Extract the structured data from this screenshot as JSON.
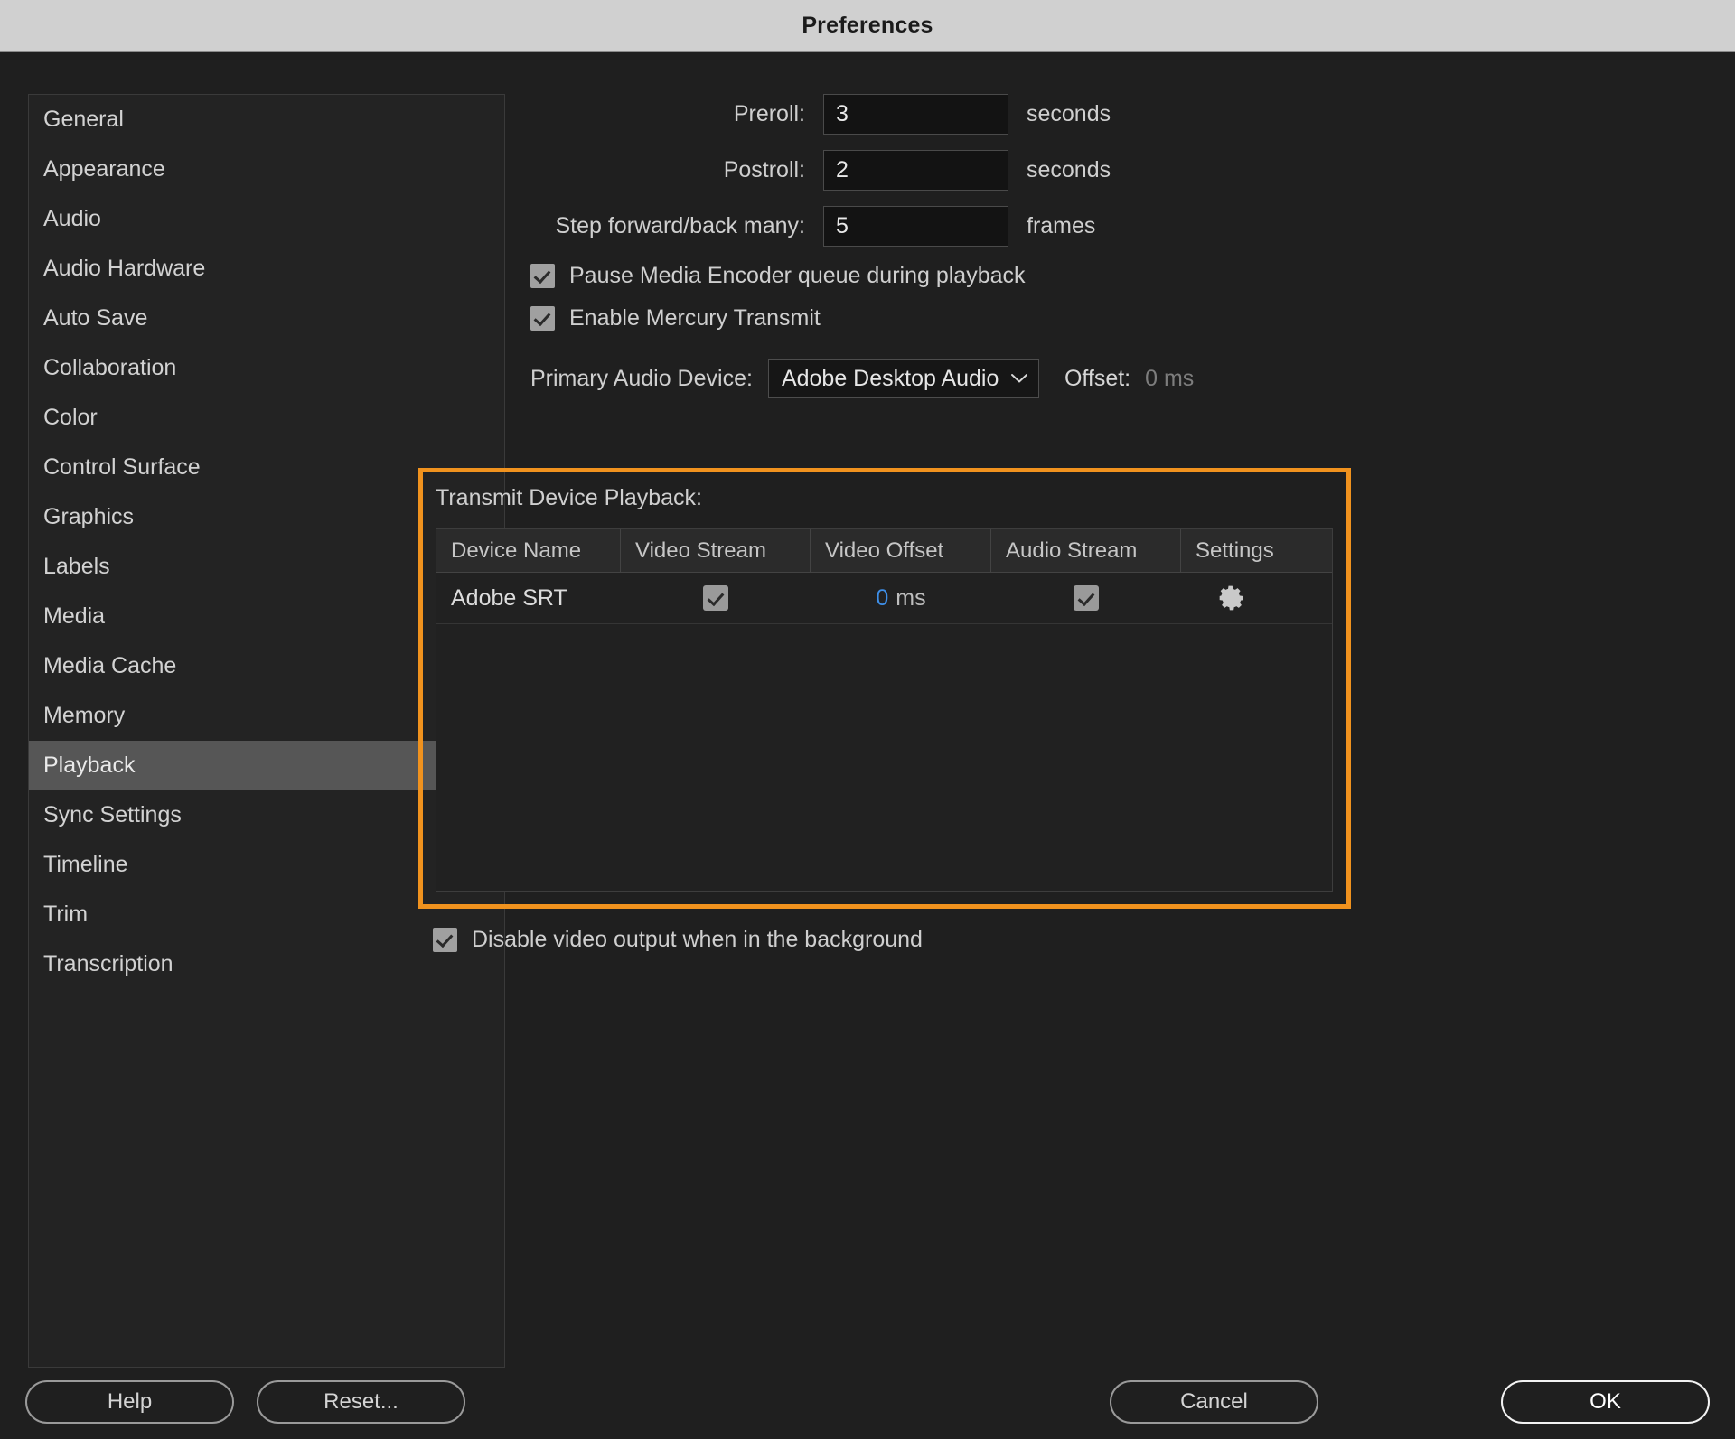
{
  "window": {
    "title": "Preferences"
  },
  "sidebar": {
    "items": [
      {
        "label": "General",
        "selected": false
      },
      {
        "label": "Appearance",
        "selected": false
      },
      {
        "label": "Audio",
        "selected": false
      },
      {
        "label": "Audio Hardware",
        "selected": false
      },
      {
        "label": "Auto Save",
        "selected": false
      },
      {
        "label": "Collaboration",
        "selected": false
      },
      {
        "label": "Color",
        "selected": false
      },
      {
        "label": "Control Surface",
        "selected": false
      },
      {
        "label": "Graphics",
        "selected": false
      },
      {
        "label": "Labels",
        "selected": false
      },
      {
        "label": "Media",
        "selected": false
      },
      {
        "label": "Media Cache",
        "selected": false
      },
      {
        "label": "Memory",
        "selected": false
      },
      {
        "label": "Playback",
        "selected": true
      },
      {
        "label": "Sync Settings",
        "selected": false
      },
      {
        "label": "Timeline",
        "selected": false
      },
      {
        "label": "Trim",
        "selected": false
      },
      {
        "label": "Transcription",
        "selected": false
      }
    ]
  },
  "playback": {
    "preroll": {
      "label": "Preroll:",
      "value": "3",
      "unit": "seconds"
    },
    "postroll": {
      "label": "Postroll:",
      "value": "2",
      "unit": "seconds"
    },
    "step": {
      "label": "Step forward/back many:",
      "value": "5",
      "unit": "frames"
    },
    "pause_encoder": {
      "label": "Pause Media Encoder queue during playback",
      "checked": true
    },
    "mercury_transmit": {
      "label": "Enable Mercury Transmit",
      "checked": true
    },
    "primary_audio_device": {
      "label": "Primary Audio Device:",
      "value": "Adobe Desktop Audio",
      "chevron_icon": "chevron-down-icon"
    },
    "offset": {
      "label": "Offset:",
      "value": "0 ms"
    },
    "disable_video_output": {
      "label": "Disable video output when in the background",
      "checked": true
    }
  },
  "transmit": {
    "title": "Transmit Device Playback:",
    "highlight_color": "#f0921e",
    "columns": [
      "Device Name",
      "Video Stream",
      "Video Offset",
      "Audio Stream",
      "Settings"
    ],
    "rows": [
      {
        "device_name": "Adobe SRT",
        "video_stream_checked": true,
        "video_offset_value": "0",
        "video_offset_unit": "ms",
        "audio_stream_checked": true,
        "settings_icon": "gear-icon"
      }
    ]
  },
  "footer": {
    "help": "Help",
    "reset": "Reset...",
    "cancel": "Cancel",
    "ok": "OK"
  }
}
